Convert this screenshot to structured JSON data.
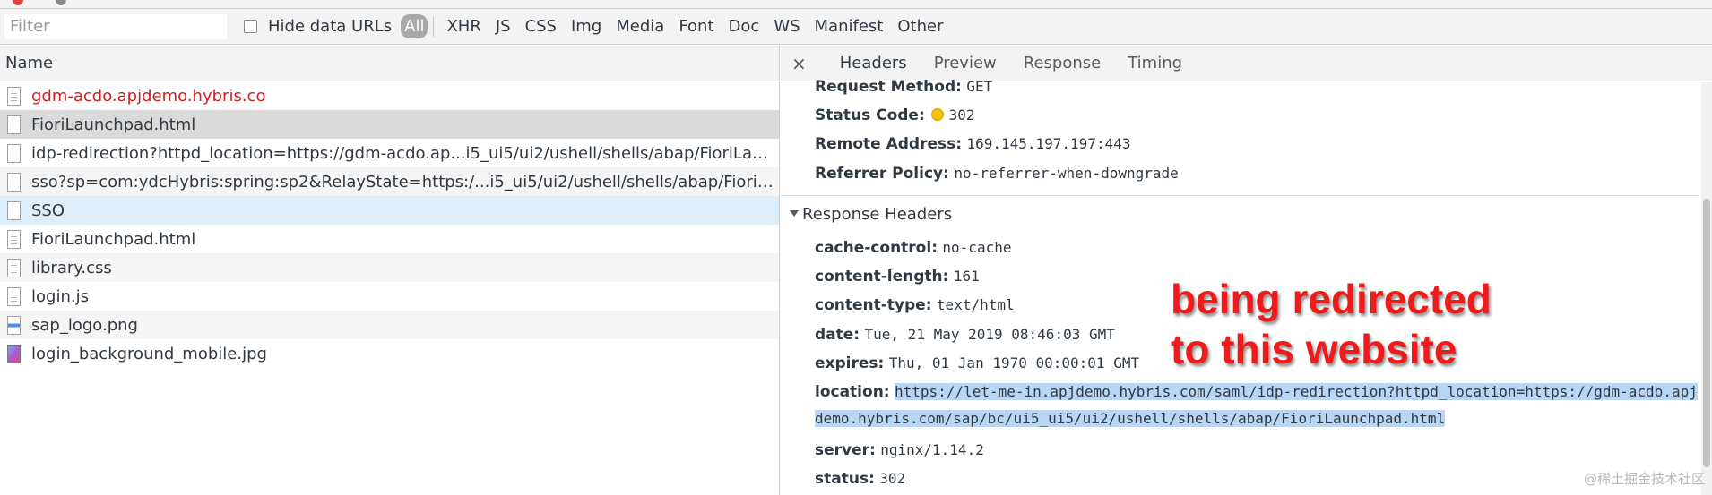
{
  "filterbar": {
    "filter_placeholder": "Filter",
    "hide_data_urls_label": "Hide data URLs",
    "types": [
      "All",
      "XHR",
      "JS",
      "CSS",
      "Img",
      "Media",
      "Font",
      "Doc",
      "WS",
      "Manifest",
      "Other"
    ]
  },
  "request_list": {
    "header": "Name",
    "rows": [
      {
        "name": "gdm-acdo.apjdemo.hybris.co",
        "icon": "document-icon",
        "state": "error"
      },
      {
        "name": "FioriLaunchpad.html",
        "icon": "blank-file-icon",
        "state": "selected"
      },
      {
        "name": "idp-redirection?httpd_location=https://gdm-acdo.ap...i5_ui5/ui2/ushell/shells/abap/FioriLaunchpad....",
        "icon": "blank-file-icon",
        "state": "normal"
      },
      {
        "name": "sso?sp=com:ydcHybris:spring:sp2&RelayState=https:/...i5_ui5/ui2/ushell/shells/abap/FioriLaunchpad...",
        "icon": "blank-file-icon",
        "state": "alt"
      },
      {
        "name": "SSO",
        "icon": "blank-file-icon",
        "state": "highlight"
      },
      {
        "name": "FioriLaunchpad.html",
        "icon": "document-icon",
        "state": "normal"
      },
      {
        "name": "library.css",
        "icon": "document-icon",
        "state": "alt"
      },
      {
        "name": "login.js",
        "icon": "document-icon",
        "state": "normal"
      },
      {
        "name": "sap_logo.png",
        "icon": "image-icon",
        "state": "alt"
      },
      {
        "name": "login_background_mobile.jpg",
        "icon": "image-icon",
        "state": "normal"
      }
    ]
  },
  "detail": {
    "close": "×",
    "tabs": [
      "Headers",
      "Preview",
      "Response",
      "Timing"
    ],
    "general": [
      {
        "key": "Request Method:",
        "value": "GET"
      },
      {
        "key": "Status Code:",
        "value": "302"
      },
      {
        "key": "Remote Address:",
        "value": "169.145.197.197:443"
      },
      {
        "key": "Referrer Policy:",
        "value": "no-referrer-when-downgrade"
      }
    ],
    "response_headers_title": "Response Headers",
    "response_headers": [
      {
        "key": "cache-control:",
        "value": "no-cache"
      },
      {
        "key": "content-length:",
        "value": "161"
      },
      {
        "key": "content-type:",
        "value": "text/html"
      },
      {
        "key": "date:",
        "value": "Tue, 21 May 2019 08:46:03 GMT"
      },
      {
        "key": "expires:",
        "value": "Thu, 01 Jan 1970 00:00:01 GMT"
      }
    ],
    "location": {
      "key": "location:",
      "value": "https://let-me-in.apjdemo.hybris.com/saml/idp-redirection?httpd_location=https://gdm-acdo.apjdemo.hybris.com/sap/bc/ui5_ui5/ui2/ushell/shells/abap/FioriLaunchpad.html"
    },
    "after_location": [
      {
        "key": "server:",
        "value": "nginx/1.14.2"
      },
      {
        "key": "status:",
        "value": "302"
      }
    ]
  },
  "annotation": {
    "line1": "being redirected",
    "line2": "to this website",
    "color": "#f01a1a"
  },
  "watermark": "@稀土掘金技术社区"
}
